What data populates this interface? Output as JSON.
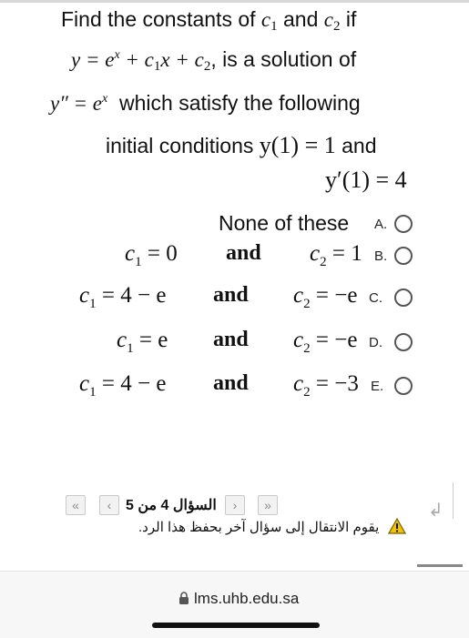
{
  "question": {
    "line1_text": "Find the constants of",
    "c": "c",
    "sub1": "1",
    "sub2": "2",
    "and_word": "and",
    "if_word": "if",
    "y_eq": "y = e",
    "x_sup": "x",
    "plus_c": " + c",
    "x_var": "x",
    "plus": " + c",
    "solution_text": ", is a solution of",
    "y_dd": "y″ = e",
    "which_text": "which satisfy the following",
    "initial_text": "initial conditions",
    "cond1": "y(1) = 1",
    "cond2": "y′(1) = 4"
  },
  "options": [
    {
      "letter": "A.",
      "text": "None of these",
      "c1": "",
      "c2": ""
    },
    {
      "letter": "B.",
      "c1_val": "0",
      "c2_val": "1"
    },
    {
      "letter": "C.",
      "c1_val": "4 − e",
      "c2_val": "−e"
    },
    {
      "letter": "D.",
      "c1_val": "e",
      "c2_val": "−e"
    },
    {
      "letter": "E.",
      "c1_val": "4 − e",
      "c2_val": "−3"
    }
  ],
  "option_and": "and",
  "navigation": {
    "question_counter": "السؤال 4 من 5",
    "warning": "يقوم الانتقال إلى سؤال آخر بحفظ هذا الرد.",
    "first_icon": "double-left-icon",
    "prev_icon": "left-icon",
    "next_icon": "right-icon",
    "last_icon": "double-right-icon"
  },
  "browser": {
    "url": "lms.uhb.edu.sa"
  }
}
